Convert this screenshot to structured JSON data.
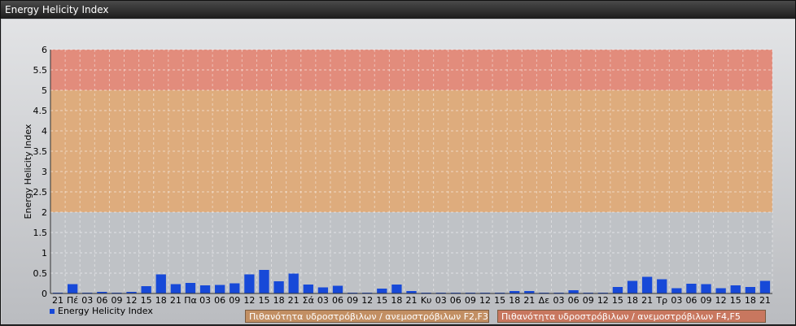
{
  "window": {
    "title": "Energy Helicity Index"
  },
  "chart_data": {
    "type": "bar",
    "title": "",
    "ylabel": "Energy Helicity Index",
    "ylim": [
      0,
      6
    ],
    "yticks": [
      "0",
      "0.5",
      "1",
      "1.5",
      "2",
      "2.5",
      "3",
      "3.5",
      "4",
      "4.5",
      "5",
      "5.5",
      "6"
    ],
    "categories": [
      "21",
      "Πέ",
      "03",
      "06",
      "09",
      "12",
      "15",
      "18",
      "21",
      "Πα",
      "03",
      "06",
      "09",
      "12",
      "15",
      "18",
      "21",
      "Σά",
      "03",
      "06",
      "09",
      "12",
      "15",
      "18",
      "21",
      "Κυ",
      "03",
      "06",
      "09",
      "12",
      "15",
      "18",
      "21",
      "Δε",
      "03",
      "06",
      "09",
      "12",
      "15",
      "18",
      "21",
      "Τρ",
      "03",
      "06",
      "09",
      "12",
      "15",
      "18",
      "21"
    ],
    "series": [
      {
        "name": "Energy Helicity Index",
        "values": [
          0.02,
          0.23,
          0.02,
          0.04,
          0.02,
          0.04,
          0.18,
          0.47,
          0.23,
          0.26,
          0.2,
          0.21,
          0.25,
          0.47,
          0.58,
          0.3,
          0.49,
          0.22,
          0.15,
          0.19,
          0.02,
          0.02,
          0.12,
          0.22,
          0.06,
          0.02,
          0.02,
          0.02,
          0.02,
          0.02,
          0.02,
          0.06,
          0.06,
          0.02,
          0.02,
          0.08,
          0.02,
          0.02,
          0.16,
          0.31,
          0.41,
          0.35,
          0.13,
          0.24,
          0.23,
          0.13,
          0.2,
          0.16,
          0.31
        ],
        "color": "#1749d8"
      }
    ],
    "bands": [
      {
        "from": 2,
        "to": 5,
        "label": "Πιθανότητα υδροστρόβιλων / ανεμοστρόβιλων F2,F3",
        "color": "#e3a870"
      },
      {
        "from": 5,
        "to": 6,
        "label": "Πιθανότητα υδροστρόβιλων / ανεμοστρόβιλων F4,F5",
        "color": "#e7836f"
      }
    ],
    "grid": true,
    "legend": "bottom-left"
  }
}
